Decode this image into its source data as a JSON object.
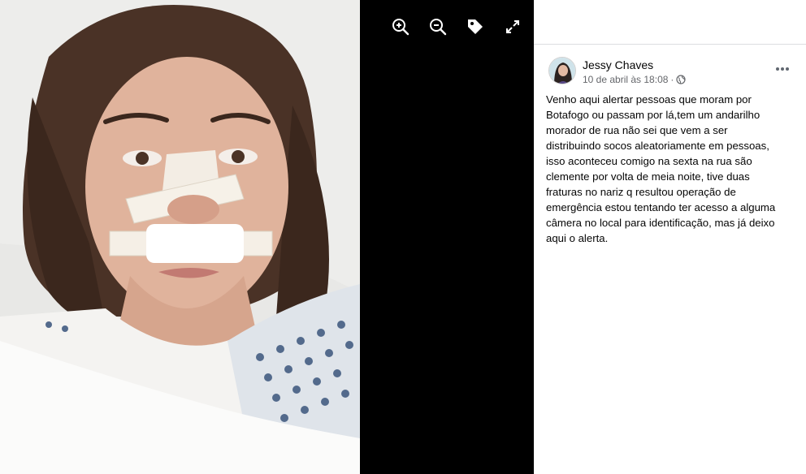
{
  "viewer": {
    "toolbar": [
      {
        "name": "zoom-in",
        "icon": "zoom-in-icon"
      },
      {
        "name": "zoom-out",
        "icon": "zoom-out-icon"
      },
      {
        "name": "tag",
        "icon": "tag-icon"
      },
      {
        "name": "fullscreen",
        "icon": "expand-icon"
      }
    ],
    "background": "#000000"
  },
  "post": {
    "author": "Jessy Chaves",
    "timestamp": "10 de abril às 18:08",
    "separator": "·",
    "privacy_icon": "globe-icon",
    "more_icon": "more-options-icon",
    "text_lines": [
      "Venho aqui alertar pessoas que moram por",
      "Botafogo ou passam por lá,tem um andarilho",
      "morador de rua não sei que vem a ser",
      "distribuindo socos aleatoriamente em pessoas,",
      "isso aconteceu comigo na sexta na rua são",
      "clemente por volta de meia noite, tive duas",
      "fraturas no nariz q resultou operação de",
      "emergência estou tentando ter acesso a alguma",
      "câmera no local para identificação, mas já deixo",
      "aqui o alerta."
    ]
  },
  "colors": {
    "text_primary": "#050505",
    "text_secondary": "#65676b",
    "divider": "#dcdde1"
  }
}
